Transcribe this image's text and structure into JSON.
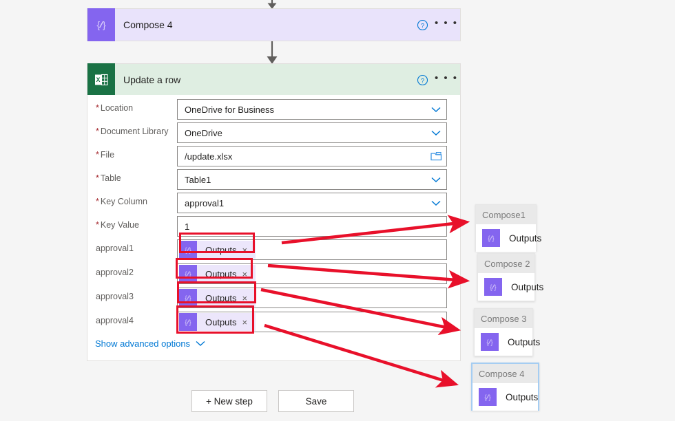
{
  "background": "#f5f5f5",
  "colors": {
    "compose_accent": "#8465ef",
    "compose_header_bg": "#e9e3fb",
    "excel_accent": "#1a7245",
    "excel_header_bg": "#dfeee2",
    "highlight_red": "#e8102a",
    "link_blue": "#0078d4",
    "required_red": "#a4262c",
    "focus_blue": "#a5cdf2"
  },
  "actions": {
    "compose": {
      "title": "Compose 4",
      "icon": "compose-braces-icon",
      "help_icon": "help-circle-icon",
      "more_icon": "ellipsis-icon",
      "more_label": "• • •"
    },
    "excel": {
      "title": "Update a row",
      "icon": "excel-icon",
      "help_icon": "help-circle-icon",
      "more_icon": "ellipsis-icon",
      "more_label": "• • •"
    }
  },
  "form": {
    "fields": [
      {
        "label": "Location",
        "required": true,
        "value": "OneDrive for Business",
        "control": "dropdown"
      },
      {
        "label": "Document Library",
        "required": true,
        "value": "OneDrive",
        "control": "dropdown"
      },
      {
        "label": "File",
        "required": true,
        "value": "/update.xlsx",
        "control": "folder"
      },
      {
        "label": "Table",
        "required": true,
        "value": "Table1",
        "control": "dropdown"
      },
      {
        "label": "Key Column",
        "required": true,
        "value": "approval1",
        "control": "dropdown"
      },
      {
        "label": "Key Value",
        "required": true,
        "value": "1",
        "control": "text"
      }
    ],
    "token_fields": [
      {
        "label": "approval1",
        "token": "Outputs",
        "remove_label": "×"
      },
      {
        "label": "approval2",
        "token": "Outputs",
        "remove_label": "×"
      },
      {
        "label": "approval3",
        "token": "Outputs",
        "remove_label": "×"
      },
      {
        "label": "approval4",
        "token": "Outputs",
        "remove_label": "×"
      }
    ],
    "advanced_options_label": "Show advanced options",
    "advanced_chevron_icon": "chevron-down-icon",
    "required_marker": "*"
  },
  "buttons": {
    "new_step": "+ New step",
    "save": "Save"
  },
  "output_cards": [
    {
      "title": "Compose1",
      "output_label": "Outputs",
      "icon": "compose-braces-icon",
      "focused": false
    },
    {
      "title": "Compose 2",
      "output_label": "Outputs",
      "icon": "compose-braces-icon",
      "focused": false
    },
    {
      "title": "Compose 3",
      "output_label": "Outputs",
      "icon": "compose-braces-icon",
      "focused": false
    },
    {
      "title": "Compose 4",
      "output_label": "Outputs",
      "icon": "compose-braces-icon",
      "focused": true
    }
  ],
  "annotations": {
    "arrow_color": "#e8102a",
    "arrow_count": 4,
    "description": "Red arrows link each approval token field to its matching Compose output card"
  }
}
